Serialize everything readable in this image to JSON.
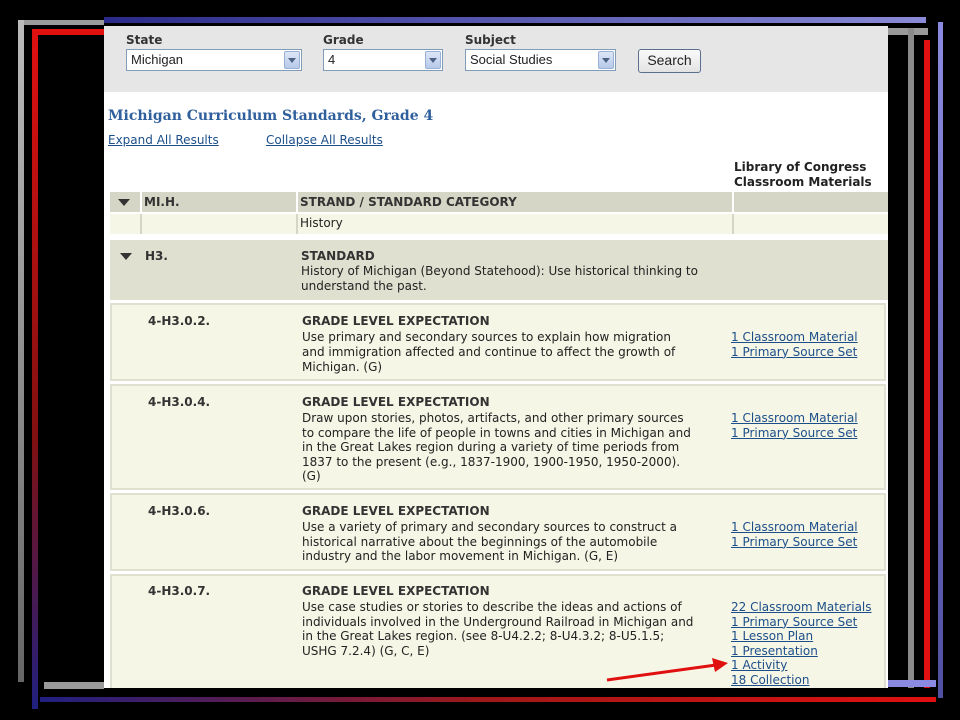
{
  "search": {
    "state_label": "State",
    "state_value": "Michigan",
    "grade_label": "Grade",
    "grade_value": "4",
    "subject_label": "Subject",
    "subject_value": "Social Studies",
    "search_button": "Search"
  },
  "page_title": "Michigan Curriculum Standards, Grade 4",
  "expand_all": "Expand All Results",
  "collapse_all": "Collapse All Results",
  "materials_header_line1": "Library of Congress",
  "materials_header_line2": "Classroom Materials",
  "strand": {
    "code": "MI.H.",
    "heading": "STRAND / STANDARD CATEGORY",
    "text": "History"
  },
  "standard": {
    "code": "H3.",
    "heading": "STANDARD",
    "text_line1": "History of Michigan (Beyond Statehood): Use historical thinking to",
    "text_line2": "understand the past."
  },
  "expectations": [
    {
      "code": "4-H3.0.2.",
      "heading": "GRADE LEVEL EXPECTATION",
      "lines": [
        "Use primary and secondary sources to explain how migration",
        "and immigration affected and continue to affect the growth of",
        "Michigan. (G)"
      ],
      "materials": [
        "1 Classroom Material",
        "1 Primary Source Set"
      ]
    },
    {
      "code": "4-H3.0.4.",
      "heading": "GRADE LEVEL EXPECTATION",
      "lines": [
        "Draw upon stories, photos, artifacts, and other primary sources",
        "to compare the life of people in towns and cities in Michigan and",
        "in the Great Lakes region during a variety of time periods from",
        "1837 to the present (e.g., 1837-1900, 1900-1950, 1950-2000).",
        "(G)"
      ],
      "materials": [
        "1 Classroom Material",
        "1 Primary Source Set"
      ]
    },
    {
      "code": "4-H3.0.6.",
      "heading": "GRADE LEVEL EXPECTATION",
      "lines": [
        "Use a variety of primary and secondary sources to construct a",
        "historical narrative about the beginnings of the automobile",
        "industry and the labor movement in Michigan. (G, E)"
      ],
      "materials": [
        "1 Classroom Material",
        "1 Primary Source Set"
      ]
    },
    {
      "code": "4-H3.0.7.",
      "heading": "GRADE LEVEL EXPECTATION",
      "lines": [
        "Use case studies or stories to describe the ideas and actions of",
        "individuals involved in the Underground Railroad in Michigan and",
        "in the Great Lakes region. (see 8-U4.2.2; 8-U4.3.2; 8-U5.1.5;",
        "USHG 7.2.4) (G, C, E)"
      ],
      "materials": [
        "22 Classroom Materials",
        "1 Primary Source Set",
        "1 Lesson Plan",
        "1 Presentation",
        "1 Activity",
        "18 Collection"
      ]
    }
  ],
  "colors": {
    "header_row": "#d6d6c6",
    "body_row": "#f6f6e6",
    "standard_row": "#e0e0d0",
    "link": "#1c4f8a",
    "title": "#2f5f9c",
    "arrow": "#e01010"
  }
}
